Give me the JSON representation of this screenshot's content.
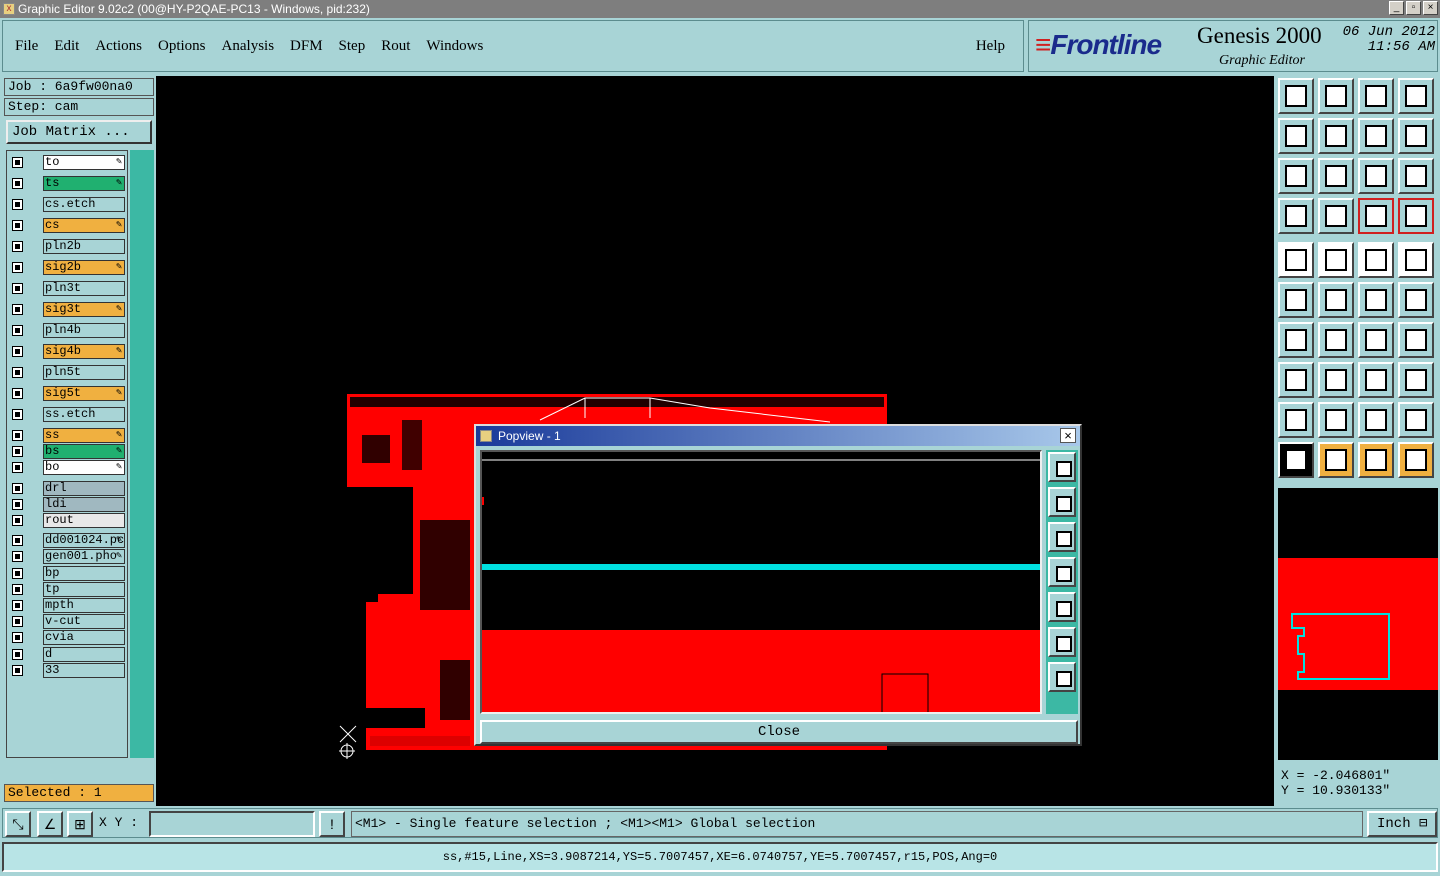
{
  "window": {
    "title": "Graphic Editor 9.02c2 (00@HY-P2QAE-PC13 - Windows, pid:232)"
  },
  "menu": [
    "File",
    "Edit",
    "Actions",
    "Options",
    "Analysis",
    "DFM",
    "Step",
    "Rout",
    "Windows"
  ],
  "help_label": "Help",
  "brand": {
    "logo": "Frontline",
    "product": "Genesis 2000",
    "subtitle": "Graphic Editor",
    "date": "06 Jun 2012",
    "time": "11:56 AM"
  },
  "job": {
    "job_line": "Job : 6a9fw00na0",
    "step_line": "Step: cam",
    "matrix_button": "Job Matrix ..."
  },
  "layers": [
    {
      "name": "to",
      "color": "#ffffff",
      "edit": true
    },
    {
      "name": "ts",
      "color": "#20b070",
      "edit": true
    },
    {
      "name": "cs.etch",
      "color": "#a8d4d6",
      "edit": false
    },
    {
      "name": "cs",
      "color": "#f0b040",
      "edit": true
    },
    {
      "name": "pln2b",
      "color": "#a8d4d6",
      "edit": false
    },
    {
      "name": "sig2b",
      "color": "#f0b040",
      "edit": true
    },
    {
      "name": "pln3t",
      "color": "#a8d4d6",
      "edit": false
    },
    {
      "name": "sig3t",
      "color": "#f0b040",
      "edit": true
    },
    {
      "name": "pln4b",
      "color": "#a8d4d6",
      "edit": false
    },
    {
      "name": "sig4b",
      "color": "#f0b040",
      "edit": true
    },
    {
      "name": "pln5t",
      "color": "#a8d4d6",
      "edit": false
    },
    {
      "name": "sig5t",
      "color": "#f0b040",
      "edit": true
    },
    {
      "name": "ss.etch",
      "color": "#a8d4d6",
      "edit": false
    },
    {
      "name": "ss",
      "color": "#f0b040",
      "edit": true
    },
    {
      "name": "bs",
      "color": "#20b070",
      "edit": true
    },
    {
      "name": "bo",
      "color": "#ffffff",
      "edit": true
    },
    {
      "name": "drl",
      "color": "#a0b8c0",
      "edit": false
    },
    {
      "name": "ldi",
      "color": "#a0b8c0",
      "edit": false
    },
    {
      "name": "rout",
      "color": "#e8e8e8",
      "edit": false
    },
    {
      "name": "dd001024.pc",
      "color": "#a8d4d6",
      "edit": true
    },
    {
      "name": "gen001.pho",
      "color": "#a8d4d6",
      "edit": true
    },
    {
      "name": "bp",
      "color": "#a8d4d6",
      "edit": false
    },
    {
      "name": "tp",
      "color": "#a8d4d6",
      "edit": false
    },
    {
      "name": "mpth",
      "color": "#a8d4d6",
      "edit": false
    },
    {
      "name": "v-cut",
      "color": "#a8d4d6",
      "edit": false
    },
    {
      "name": "cvia",
      "color": "#a8d4d6",
      "edit": false
    },
    {
      "name": "d",
      "color": "#a8d4d6",
      "edit": false
    },
    {
      "name": "33",
      "color": "#a8d4d6",
      "edit": false
    }
  ],
  "selected_text": "Selected : 1",
  "popup": {
    "title": "Popview - 1",
    "close_label": "Close"
  },
  "coords": {
    "x": "X = -2.046801\"",
    "y": "Y = 10.930133\""
  },
  "xy_label": "X Y :",
  "hint": "<M1> - Single feature selection ; <M1><M1> Global selection",
  "units": "Inch",
  "status": "ss,#15,Line,XS=3.9087214,YS=5.7007457,XE=6.0740757,YE=5.7007457,r15,POS,Ang=0",
  "colors": {
    "board": "#ff0000",
    "highlight": "#00e0e0",
    "panel": "#a8d4d6"
  }
}
